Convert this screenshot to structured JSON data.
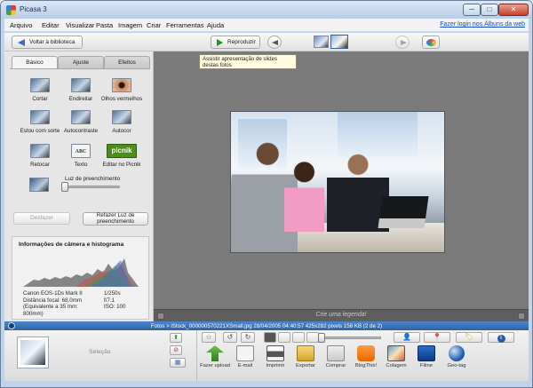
{
  "window": {
    "title": "Picasa 3",
    "min": "─",
    "max": "□",
    "close": "✕"
  },
  "menu": {
    "items": [
      "Arquivo",
      "Editar",
      "Visualizar",
      "Pasta",
      "Imagem",
      "Criar",
      "Ferramentas",
      "Ajuda"
    ],
    "login_link": "Fazer login nos Álbuns da web"
  },
  "toolbar": {
    "back_label": "Voltar à biblioteca",
    "play_label": "Reproduzir"
  },
  "tooltip": "Assistir apresentação de slides destas fotos",
  "tabs": [
    "Básico",
    "Ajuste",
    "Efeitos"
  ],
  "tools": [
    {
      "label": "Cortar",
      "icon": "crop-icon"
    },
    {
      "label": "Endireitar",
      "icon": "straighten-icon"
    },
    {
      "label": "Olhos vermelhos",
      "icon": "red-eye-icon"
    },
    {
      "label": "Estou com sorte",
      "icon": "im-feeling-lucky-icon"
    },
    {
      "label": "Autocontraste",
      "icon": "auto-contrast-icon"
    },
    {
      "label": "Autocor",
      "icon": "auto-color-icon"
    },
    {
      "label": "Retocar",
      "icon": "retouch-icon"
    },
    {
      "label": "Texto",
      "icon": "text-icon",
      "glyph": "ABC"
    },
    {
      "label": "Editar no Picnik",
      "icon": "picnik-icon",
      "glyph": "picnik"
    }
  ],
  "fill_light": {
    "label": "Luz de preenchimento",
    "value": 0
  },
  "buttons": {
    "undo": "Desfazer",
    "redo": "Refazer Luz de preenchimento"
  },
  "camera_info": {
    "title": "Informações de câmera e histograma",
    "camera": "Canon EOS-1Ds Mark II",
    "focal": "Distância focal: 68.0mm",
    "equiv": "(Equivalente a 35 mm:",
    "equiv2": "800mm)",
    "shutter": "1/250s",
    "aperture": "f/7.1",
    "iso": "ISO: 100"
  },
  "caption_placeholder": "Crie uma legenda!",
  "status": {
    "text": "Fotos > iStock_000000570221XSmall.jpg     28/04/2005 04:40:57     425x282 pixels     158 KB     (2 de 2)"
  },
  "tray": {
    "selection_label": "Seleção",
    "hold_glyph": "⬆",
    "clear_glyph": "⊘",
    "album_glyph": "▦"
  },
  "small_tools": {
    "star": "☆",
    "rotate_left": "↺",
    "rotate_right": "↻",
    "people": "👤",
    "geo": "📍",
    "tag": "🏷",
    "info": "i"
  },
  "actions": [
    {
      "label": "Fazer upload",
      "icon": "upload-icon"
    },
    {
      "label": "E-mail",
      "icon": "email-icon"
    },
    {
      "label": "Imprimir",
      "icon": "print-icon"
    },
    {
      "label": "Exportar",
      "icon": "export-icon"
    },
    {
      "label": "Comprar",
      "icon": "buy-icon"
    },
    {
      "label": "BlogThis!",
      "icon": "blogger-icon"
    },
    {
      "label": "Colagem",
      "icon": "collage-icon"
    },
    {
      "label": "Filme",
      "icon": "movie-icon"
    },
    {
      "label": "Geo-tag",
      "icon": "geotag-icon"
    }
  ],
  "colors": {
    "accent": "#2c63a8",
    "picnik_green": "#4e8d1d",
    "view_bg": "#7a7a7a"
  }
}
